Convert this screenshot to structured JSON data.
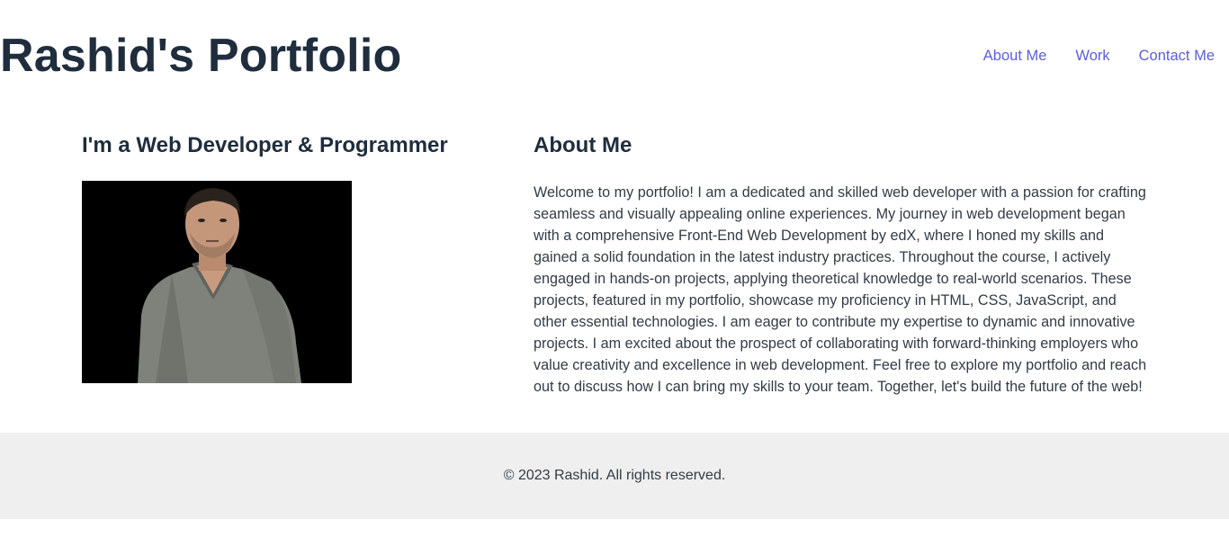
{
  "header": {
    "site_title": "Rashid's Portfolio",
    "nav": [
      {
        "label": "About Me"
      },
      {
        "label": "Work"
      },
      {
        "label": "Contact Me"
      }
    ]
  },
  "main": {
    "intro_heading": "I'm a Web Developer & Programmer",
    "photo_alt": "Portrait photo of Rashid",
    "about_heading": "About Me",
    "about_text": "Welcome to my portfolio! I am a dedicated and skilled web developer with a passion for crafting seamless and visually appealing online experiences. My journey in web development began with a comprehensive Front-End Web Development by edX, where I honed my skills and gained a solid foundation in the latest industry practices. Throughout the course, I actively engaged in hands-on projects, applying theoretical knowledge to real-world scenarios. These projects, featured in my portfolio, showcase my proficiency in HTML, CSS, JavaScript, and other essential technologies. I am eager to contribute my expertise to dynamic and innovative projects. I am excited about the prospect of collaborating with forward-thinking employers who value creativity and excellence in web development. Feel free to explore my portfolio and reach out to discuss how I can bring my skills to your team. Together, let's build the future of the web!"
  },
  "footer": {
    "copyright": "© 2023 Rashid. All rights reserved."
  },
  "colors": {
    "heading": "#1f2d3d",
    "nav_link": "#5b5fd6",
    "footer_bg": "#efefef",
    "body_text": "#333b45"
  }
}
